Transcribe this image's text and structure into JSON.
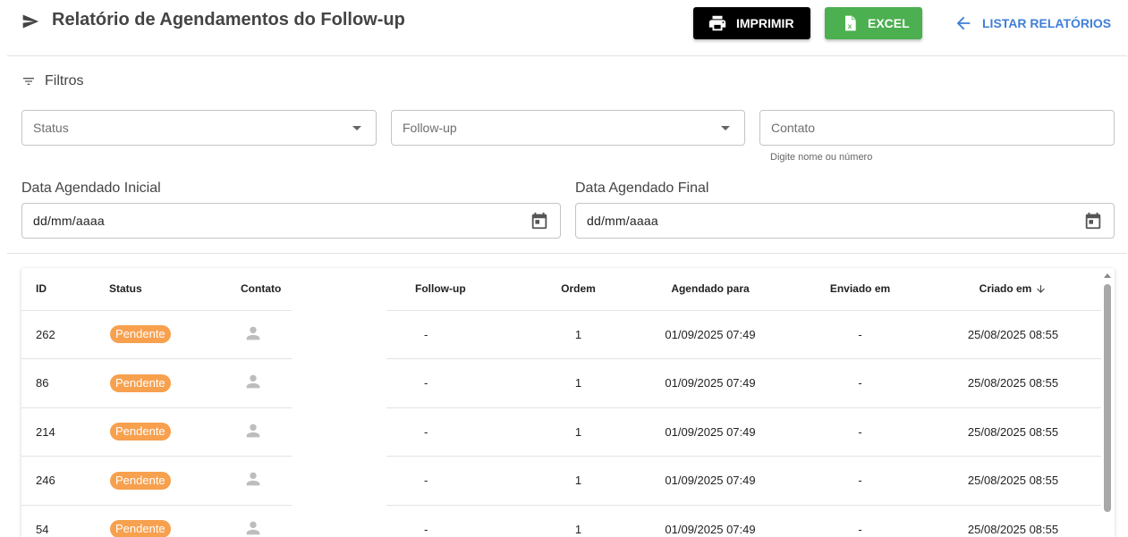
{
  "header": {
    "title": "Relatório de Agendamentos do Follow-up",
    "print_label": "IMPRIMIR",
    "excel_label": "EXCEL",
    "list_label": "LISTAR RELATÓRIOS"
  },
  "filters": {
    "heading": "Filtros",
    "status_placeholder": "Status",
    "followup_placeholder": "Follow-up",
    "contact_placeholder": "Contato",
    "contact_helper": "Digite nome ou número",
    "date_start_label": "Data Agendado Inicial",
    "date_start_value": "dd/mm/aaaa",
    "date_end_label": "Data Agendado Final",
    "date_end_value": "dd/mm/aaaa"
  },
  "table": {
    "columns": [
      "ID",
      "Status",
      "Contato",
      "Follow-up",
      "Ordem",
      "Agendado para",
      "Enviado em",
      "Criado em"
    ],
    "rows": [
      {
        "id": "262",
        "status": "Pendente",
        "followup": "-",
        "ordem": "1",
        "agendado": "01/09/2025 07:49",
        "enviado": "-",
        "criado": "25/08/2025 08:55"
      },
      {
        "id": "86",
        "status": "Pendente",
        "followup": "-",
        "ordem": "1",
        "agendado": "01/09/2025 07:49",
        "enviado": "-",
        "criado": "25/08/2025 08:55"
      },
      {
        "id": "214",
        "status": "Pendente",
        "followup": "-",
        "ordem": "1",
        "agendado": "01/09/2025 07:49",
        "enviado": "-",
        "criado": "25/08/2025 08:55"
      },
      {
        "id": "246",
        "status": "Pendente",
        "followup": "-",
        "ordem": "1",
        "agendado": "01/09/2025 07:49",
        "enviado": "-",
        "criado": "25/08/2025 08:55"
      },
      {
        "id": "54",
        "status": "Pendente",
        "followup": "-",
        "ordem": "1",
        "agendado": "01/09/2025 07:49",
        "enviado": "-",
        "criado": "25/08/2025 08:55"
      }
    ]
  },
  "colors": {
    "print_bg": "#000000",
    "excel_bg": "#4caf50",
    "link_blue": "#3f7fd6",
    "badge_orange": "#f7a04e"
  },
  "icons": {
    "title": "send-icon",
    "print": "printer-icon",
    "excel": "excel-file-icon",
    "back": "arrow-left-icon",
    "filter": "filter-list-icon",
    "calendar": "calendar-icon",
    "avatar": "person-icon",
    "sort": "arrow-down-icon"
  }
}
